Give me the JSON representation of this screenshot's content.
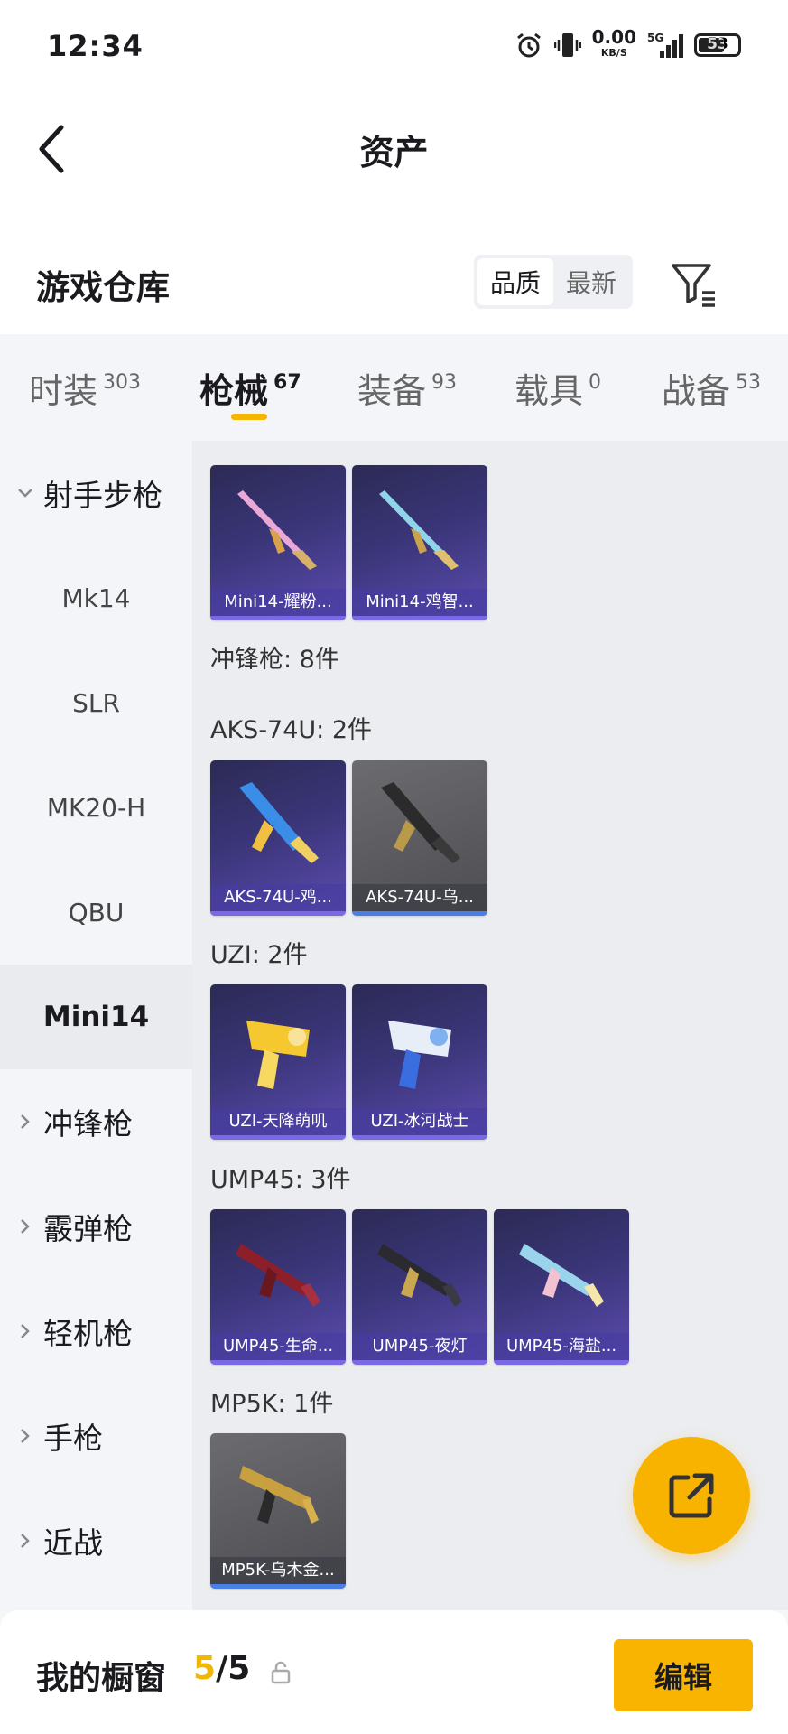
{
  "status_bar": {
    "time": "12:34",
    "net_speed": "0.00",
    "net_unit": "KB/S",
    "network": "5G",
    "battery": "53"
  },
  "header": {
    "title": "资产"
  },
  "warehouse": {
    "title": "游戏仓库",
    "sort_options": [
      "品质",
      "最新"
    ],
    "active_sort": "品质"
  },
  "tabs": [
    {
      "label": "时装",
      "count": "303"
    },
    {
      "label": "枪械",
      "count": "67"
    },
    {
      "label": "装备",
      "count": "93"
    },
    {
      "label": "载具",
      "count": "0"
    },
    {
      "label": "战备",
      "count": "53"
    }
  ],
  "active_tab": "枪械",
  "sidebar": {
    "items": [
      {
        "label": "射手步枪",
        "type": "category",
        "expanded": true
      },
      {
        "label": "Mk14",
        "type": "sub"
      },
      {
        "label": "SLR",
        "type": "sub"
      },
      {
        "label": "MK20-H",
        "type": "sub"
      },
      {
        "label": "QBU",
        "type": "sub"
      },
      {
        "label": "Mini14",
        "type": "sub",
        "selected": true
      },
      {
        "label": "冲锋枪",
        "type": "category"
      },
      {
        "label": "霰弹枪",
        "type": "category"
      },
      {
        "label": "轻机枪",
        "type": "category"
      },
      {
        "label": "手枪",
        "type": "category"
      },
      {
        "label": "近战",
        "type": "category"
      }
    ]
  },
  "content": {
    "sections": [
      {
        "label": "冲锋枪: 8件"
      },
      {
        "label": "AKS-74U: 2件"
      },
      {
        "label": "UZI: 2件"
      },
      {
        "label": "UMP45: 3件"
      },
      {
        "label": "MP5K: 1件"
      }
    ],
    "cards": [
      {
        "label": "Mini14-耀粉...",
        "icon": "mini14-rifle-icon",
        "style": "purple"
      },
      {
        "label": "Mini14-鸡智...",
        "icon": "mini14-rifle-icon",
        "style": "purple"
      },
      {
        "label": "AKS-74U-鸡...",
        "icon": "aks74u-icon",
        "style": "purple"
      },
      {
        "label": "AKS-74U-乌...",
        "icon": "aks74u-icon",
        "style": "grey"
      },
      {
        "label": "UZI-天降萌叽",
        "icon": "uzi-icon",
        "style": "purple"
      },
      {
        "label": "UZI-冰河战士",
        "icon": "uzi-icon",
        "style": "purple"
      },
      {
        "label": "UMP45-生命...",
        "icon": "ump45-icon",
        "style": "purple"
      },
      {
        "label": "UMP45-夜灯",
        "icon": "ump45-icon",
        "style": "purple"
      },
      {
        "label": "UMP45-海盐...",
        "icon": "ump45-icon",
        "style": "purple"
      },
      {
        "label": "MP5K-乌木金...",
        "icon": "mp5k-icon",
        "style": "grey"
      }
    ]
  },
  "showcase": {
    "title": "我的橱窗",
    "current": "5",
    "separator": "/",
    "total": "5",
    "edit_label": "编辑"
  },
  "colors": {
    "accent": "#f8b400",
    "card_purple": "#3a3578",
    "card_grey": "#5a5a5f"
  }
}
